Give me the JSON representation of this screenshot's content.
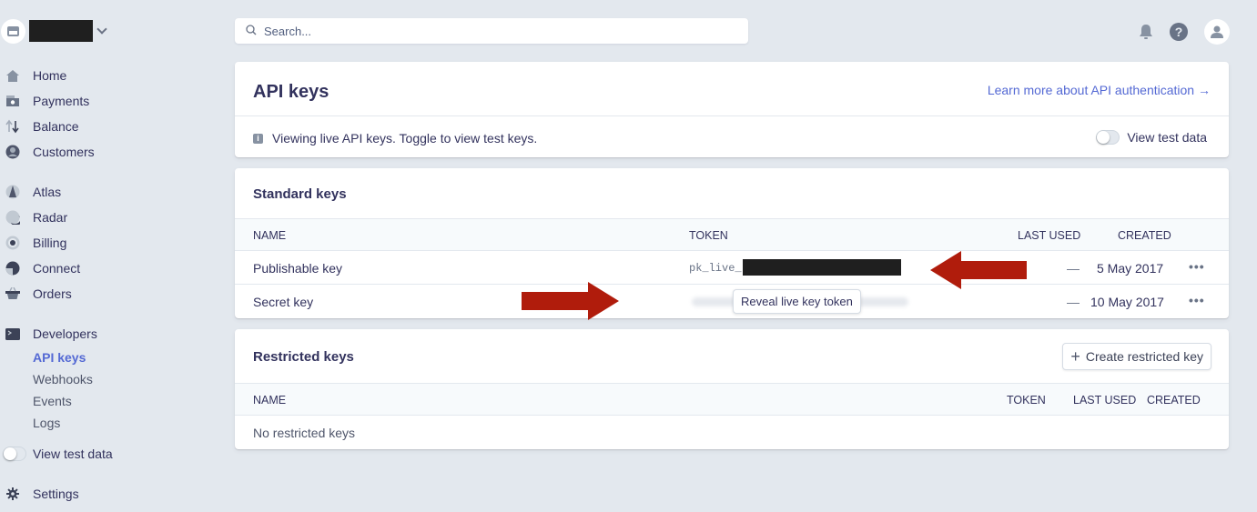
{
  "colors": {
    "accent": "#5469d4",
    "background": "#e3e8ee",
    "text": "#32325d",
    "annotation_arrow": "#b01c0c"
  },
  "sidebar": {
    "account": {
      "name": "[redacted]",
      "icon": "store-icon"
    },
    "primary": [
      {
        "label": "Home",
        "icon": "home-icon"
      },
      {
        "label": "Payments",
        "icon": "payments-icon"
      },
      {
        "label": "Balance",
        "icon": "balance-icon"
      },
      {
        "label": "Customers",
        "icon": "customers-icon"
      }
    ],
    "products": [
      {
        "label": "Atlas",
        "icon": "atlas-icon"
      },
      {
        "label": "Radar",
        "icon": "radar-icon"
      },
      {
        "label": "Billing",
        "icon": "billing-icon"
      },
      {
        "label": "Connect",
        "icon": "connect-icon"
      },
      {
        "label": "Orders",
        "icon": "orders-icon"
      }
    ],
    "developers": {
      "label": "Developers",
      "icon": "terminal-icon",
      "children": [
        {
          "label": "API keys",
          "active": true
        },
        {
          "label": "Webhooks",
          "active": false
        },
        {
          "label": "Events",
          "active": false
        },
        {
          "label": "Logs",
          "active": false
        }
      ]
    },
    "test_toggle": {
      "label": "View test data",
      "on": false
    },
    "settings": {
      "label": "Settings",
      "icon": "gear-icon"
    }
  },
  "topbar": {
    "search_placeholder": "Search...",
    "icons": [
      "bell-icon",
      "help-icon",
      "user-avatar-icon"
    ]
  },
  "header_card": {
    "title": "API keys",
    "learn_link": "Learn more about API authentication →",
    "info_text": "Viewing live API keys. Toggle to view test keys.",
    "toggle_label": "View test data",
    "toggle_on": false
  },
  "standard_keys": {
    "title": "Standard keys",
    "columns": [
      "NAME",
      "TOKEN",
      "LAST USED",
      "CREATED"
    ],
    "rows": [
      {
        "name": "Publishable key",
        "token_prefix": "pk_live_",
        "token_redacted": true,
        "last_used": "—",
        "created": "5 May 2017",
        "menu": "•••"
      },
      {
        "name": "Secret key",
        "token_hidden": true,
        "reveal_label": "Reveal live key token",
        "last_used": "—",
        "created": "10 May 2017",
        "menu": "•••"
      }
    ]
  },
  "restricted_keys": {
    "title": "Restricted keys",
    "create_button": "Create restricted key",
    "columns": [
      "NAME",
      "TOKEN",
      "LAST USED",
      "CREATED"
    ],
    "empty_text": "No restricted keys"
  },
  "annotations": [
    {
      "type": "arrow",
      "direction": "left",
      "points_to": "publishable-key-token"
    },
    {
      "type": "arrow",
      "direction": "right",
      "points_to": "reveal-secret-key-button"
    }
  ]
}
